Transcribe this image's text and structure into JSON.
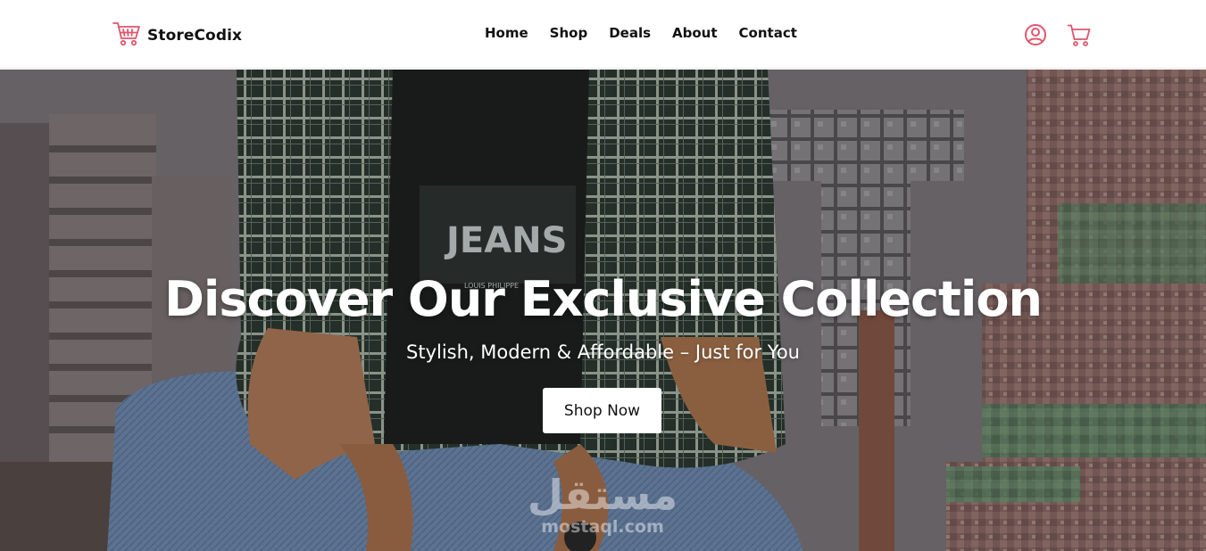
{
  "brand": {
    "name": "StoreCodix",
    "logo_icon": "shopping-cart-icon",
    "accent": "#e0566c"
  },
  "nav": {
    "items": [
      {
        "label": "Home"
      },
      {
        "label": "Shop"
      },
      {
        "label": "Deals"
      },
      {
        "label": "About"
      },
      {
        "label": "Contact"
      }
    ]
  },
  "header_icons": {
    "user": "user-circle-icon",
    "cart": "cart-icon",
    "color": "#e0566c"
  },
  "hero": {
    "title": "Discover Our Exclusive Collection",
    "subtitle": "Stylish, Modern & Affordable – Just for You",
    "cta_label": "Shop Now",
    "shirt_print": "JEANS",
    "shirt_brand": "LOUIS PHILIPPE"
  },
  "watermark": {
    "arabic": "مستقل",
    "latin": "mostaql.com"
  }
}
